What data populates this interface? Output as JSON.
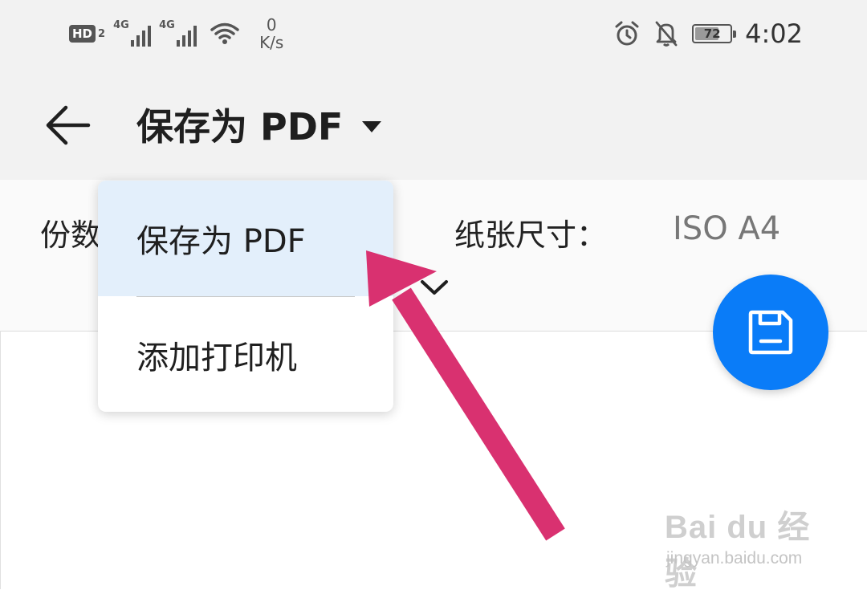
{
  "status_bar": {
    "hd_badge": "HD",
    "hd_sub": "2",
    "sim1_network": "4G",
    "sim2_network": "4G",
    "speed_value": "0",
    "speed_unit": "K/s",
    "battery_level": "72",
    "time": "4:02",
    "icons": [
      "hd-icon",
      "signal-icon",
      "signal-icon",
      "wifi-icon",
      "alarm-icon",
      "bell-off-icon",
      "battery-icon"
    ]
  },
  "toolbar": {
    "back_icon": "back-arrow-icon",
    "title": "保存为 PDF",
    "dropdown_icon": "caret-down-icon"
  },
  "options": {
    "copies_label": "份数",
    "paper_size_label": "纸张尺寸：",
    "paper_size_value": "ISO A4",
    "expand_icon": "chevron-down-icon"
  },
  "dropdown_menu": {
    "items": [
      {
        "label": "保存为 PDF",
        "selected": true
      },
      {
        "label": "添加打印机",
        "selected": false
      }
    ]
  },
  "fab": {
    "icon": "save-icon",
    "color": "#0a7cf8"
  },
  "annotation": {
    "arrow_color": "#d93170"
  },
  "watermark": {
    "logo_text": "Bai du 经验",
    "url": "jingyan.baidu.com"
  }
}
